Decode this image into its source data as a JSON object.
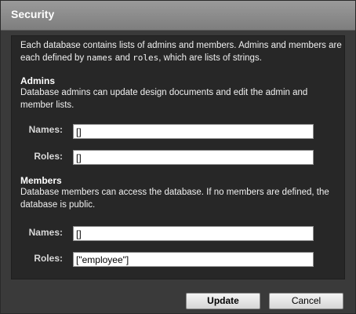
{
  "dialog": {
    "title": "Security"
  },
  "intro": {
    "text_a": "Each database contains lists of admins and members. Admins and members are each defined by ",
    "code_names": "names",
    "text_b": " and ",
    "code_roles": "roles",
    "text_c": ", which are lists of strings."
  },
  "admins": {
    "heading": "Admins",
    "description": "Database admins can update design documents and edit the admin and member lists.",
    "names_label": "Names:",
    "names_value": "[]",
    "roles_label": "Roles:",
    "roles_value": "[]"
  },
  "members": {
    "heading": "Members",
    "description": "Database members can access the database. If no members are defined, the database is public.",
    "names_label": "Names:",
    "names_value": "[]",
    "roles_label": "Roles:",
    "roles_value": "[\"employee\"]"
  },
  "buttons": {
    "update": "Update",
    "cancel": "Cancel"
  }
}
